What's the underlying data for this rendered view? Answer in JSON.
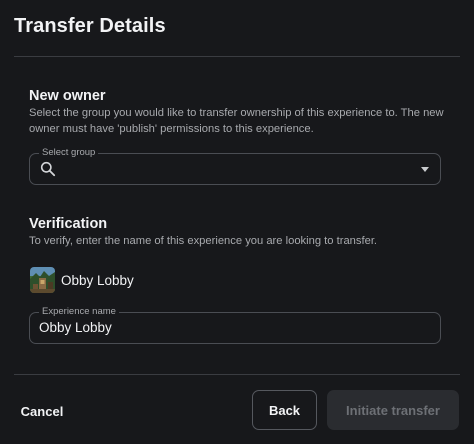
{
  "header": {
    "title": "Transfer Details"
  },
  "new_owner": {
    "title": "New owner",
    "description": "Select the group you would like to transfer ownership of this experience to. The new owner must have 'publish' permissions to this experience.",
    "select": {
      "label": "Select group",
      "value": ""
    }
  },
  "verification": {
    "title": "Verification",
    "description": "To verify, enter the name of this experience you are looking to transfer.",
    "experience": {
      "name": "Obby Lobby"
    },
    "name_field": {
      "label": "Experience name",
      "value": "Obby Lobby"
    }
  },
  "footer": {
    "cancel_label": "Cancel",
    "back_label": "Back",
    "initiate_label": "Initiate transfer"
  },
  "colors": {
    "background": "#17181b",
    "divider": "#3a3c41",
    "disabled_button": "#2a2c30"
  }
}
